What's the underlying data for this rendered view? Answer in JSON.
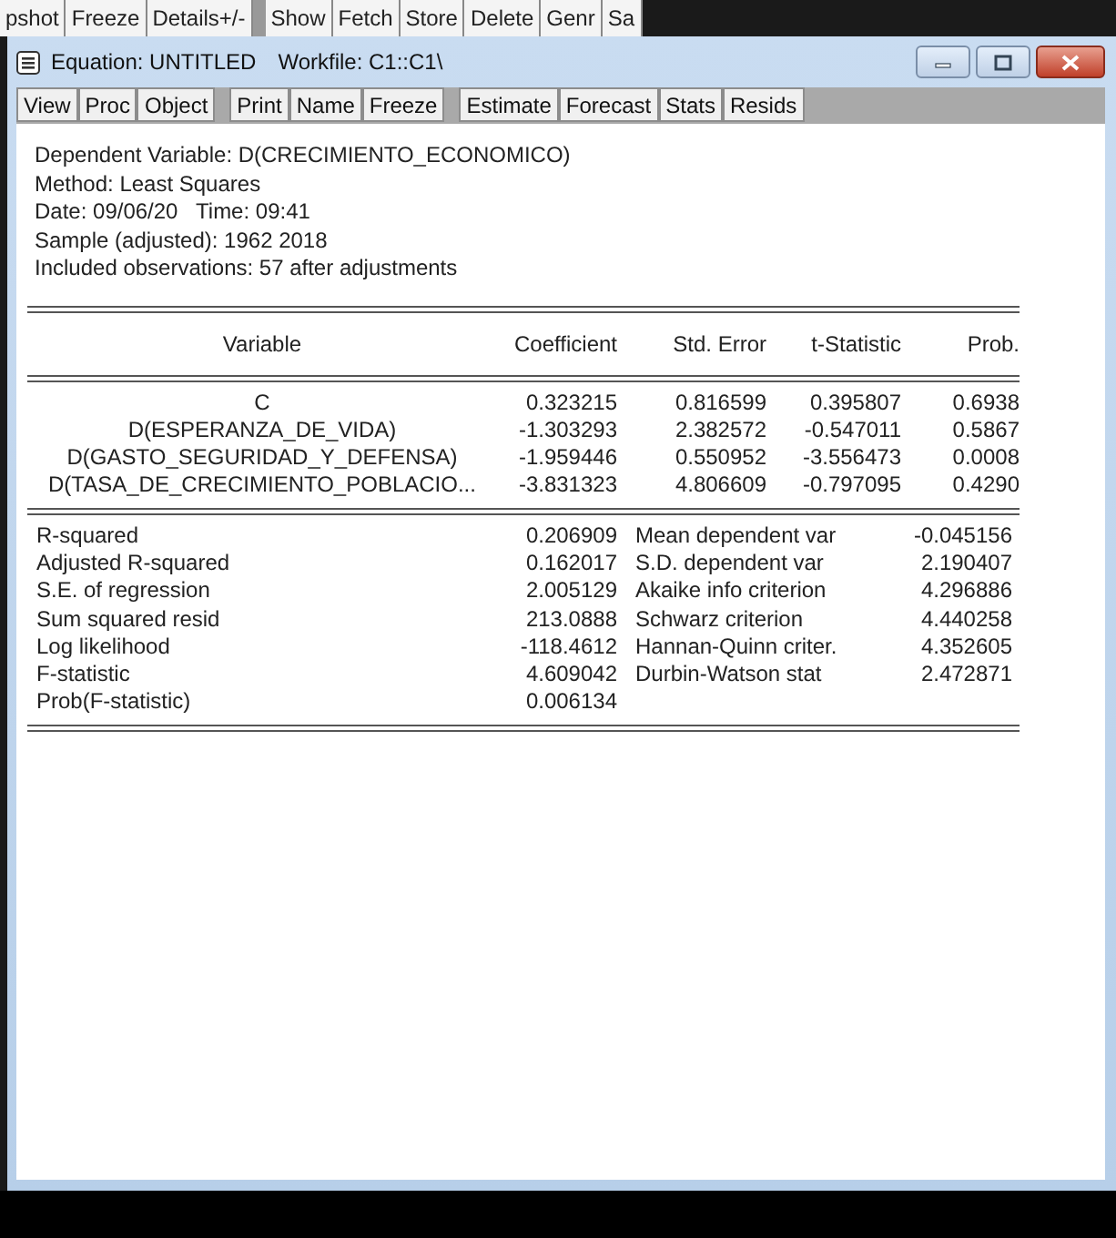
{
  "app_toolbar": {
    "groups": [
      [
        "pshot",
        "Freeze",
        "Details+/-"
      ],
      [
        "Show",
        "Fetch",
        "Store",
        "Delete",
        "Genr",
        "Sa"
      ]
    ]
  },
  "window": {
    "title": "Equation: UNTITLED",
    "workfile": "Workfile: C1::C1\\"
  },
  "toolbar": {
    "groups": [
      [
        "View",
        "Proc",
        "Object"
      ],
      [
        "Print",
        "Name",
        "Freeze"
      ],
      [
        "Estimate",
        "Forecast",
        "Stats",
        "Resids"
      ]
    ]
  },
  "header_lines": [
    "Dependent Variable: D(CRECIMIENTO_ECONOMICO)",
    "Method: Least Squares",
    "Date: 09/06/20   Time: 09:41",
    "Sample (adjusted): 1962 2018",
    "Included observations: 57 after adjustments"
  ],
  "coefficients": {
    "columns": [
      "Variable",
      "Coefficient",
      "Std. Error",
      "t-Statistic",
      "Prob."
    ],
    "rows": [
      {
        "variable": "C",
        "coefficient": "0.323215",
        "std_error": "0.816599",
        "t_statistic": "0.395807",
        "prob": "0.6938"
      },
      {
        "variable": "D(ESPERANZA_DE_VIDA)",
        "coefficient": "-1.303293",
        "std_error": "2.382572",
        "t_statistic": "-0.547011",
        "prob": "0.5867"
      },
      {
        "variable": "D(GASTO_SEGURIDAD_Y_DEFENSA)",
        "coefficient": "-1.959446",
        "std_error": "0.550952",
        "t_statistic": "-3.556473",
        "prob": "0.0008"
      },
      {
        "variable": "D(TASA_DE_CRECIMIENTO_POBLACIO...",
        "coefficient": "-3.831323",
        "std_error": "4.806609",
        "t_statistic": "-0.797095",
        "prob": "0.4290"
      }
    ]
  },
  "statistics": [
    {
      "label": "R-squared",
      "value": "0.206909",
      "label_2": "Mean dependent var",
      "value_2": "-0.045156"
    },
    {
      "label": "Adjusted R-squared",
      "value": "0.162017",
      "label_2": "S.D. dependent var",
      "value_2": "2.190407"
    },
    {
      "label": "S.E. of regression",
      "value": "2.005129",
      "label_2": "Akaike info criterion",
      "value_2": "4.296886"
    },
    {
      "label": "Sum squared resid",
      "value": "213.0888",
      "label_2": "Schwarz criterion",
      "value_2": "4.440258"
    },
    {
      "label": "Log likelihood",
      "value": "-118.4612",
      "label_2": "Hannan-Quinn criter.",
      "value_2": "4.352605"
    },
    {
      "label": "F-statistic",
      "value": "4.609042",
      "label_2": "Durbin-Watson stat",
      "value_2": "2.472871"
    },
    {
      "label": "Prob(F-statistic)",
      "value": "0.006134"
    }
  ]
}
